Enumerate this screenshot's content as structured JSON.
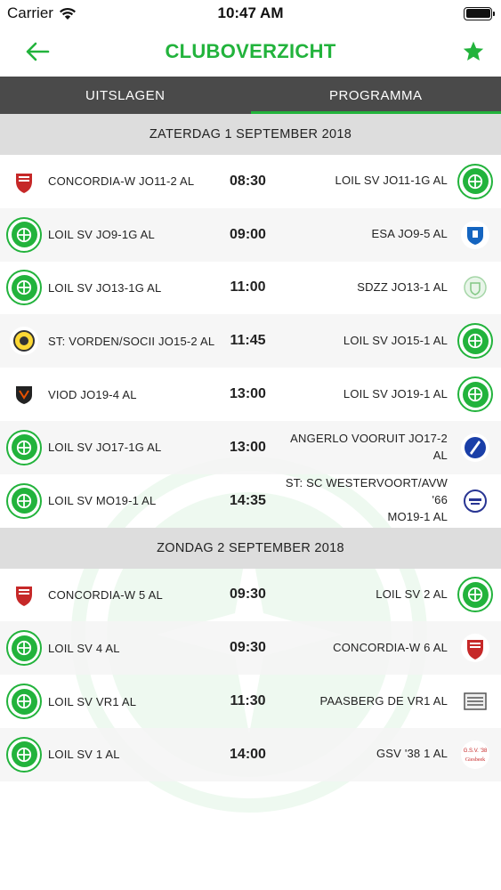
{
  "status": {
    "carrier": "Carrier",
    "time": "10:47 AM"
  },
  "nav": {
    "title": "CLUBOVERZICHT",
    "back_icon": "arrow-left-icon",
    "favorite_icon": "star-icon",
    "accent": "#22b33c"
  },
  "tabs": [
    {
      "label": "UITSLAGEN",
      "active": false
    },
    {
      "label": "PROGRAMMA",
      "active": true
    }
  ],
  "days": [
    {
      "label": "ZATERDAG 1 SEPTEMBER 2018",
      "matches": [
        {
          "home": "CONCORDIA-W JO11-2 AL",
          "time": "08:30",
          "away": "LOIL SV JO11-1G AL"
        },
        {
          "home": "LOIL SV JO9-1G AL",
          "time": "09:00",
          "away": "ESA JO9-5 AL"
        },
        {
          "home": "LOIL SV JO13-1G AL",
          "time": "11:00",
          "away": "SDZZ JO13-1 AL"
        },
        {
          "home": "ST: VORDEN/SOCII JO15-2 AL",
          "time": "11:45",
          "away": "LOIL SV JO15-1 AL"
        },
        {
          "home": "VIOD JO19-4 AL",
          "time": "13:00",
          "away": "LOIL SV JO19-1 AL"
        },
        {
          "home": "LOIL SV JO17-1G AL",
          "time": "13:00",
          "away": "ANGERLO VOORUIT JO17-2 AL"
        },
        {
          "home": "LOIL SV MO19-1 AL",
          "time": "14:35",
          "away_line1": "ST: SC WESTERVOORT/AVW '66",
          "away_line2": "MO19-1 AL"
        }
      ]
    },
    {
      "label": "ZONDAG 2 SEPTEMBER 2018",
      "matches": [
        {
          "home": "CONCORDIA-W 5 AL",
          "time": "09:30",
          "away": "LOIL SV 2 AL"
        },
        {
          "home": "LOIL SV 4 AL",
          "time": "09:30",
          "away": "CONCORDIA-W 6 AL"
        },
        {
          "home": "LOIL SV VR1 AL",
          "time": "11:30",
          "away": "PAASBERG DE VR1 AL"
        },
        {
          "home": "LOIL SV 1 AL",
          "time": "14:00",
          "away": "GSV '38 1 AL"
        }
      ]
    }
  ],
  "logos": {
    "own_club": "loil-sv-logo",
    "concordia": "concordia-w-logo",
    "esa": "esa-logo",
    "sdzz": "sdzz-logo",
    "vorden": "vorden-logo",
    "viod": "viod-logo",
    "angerlo": "angerlo-vooruit-logo",
    "westervoort": "westervoort-logo",
    "paasberg": "paasberg-logo",
    "gsv": "gsv-38-logo",
    "gsv_text_1": "G.S.V. '38",
    "gsv_text_2": "Giesbeek"
  }
}
